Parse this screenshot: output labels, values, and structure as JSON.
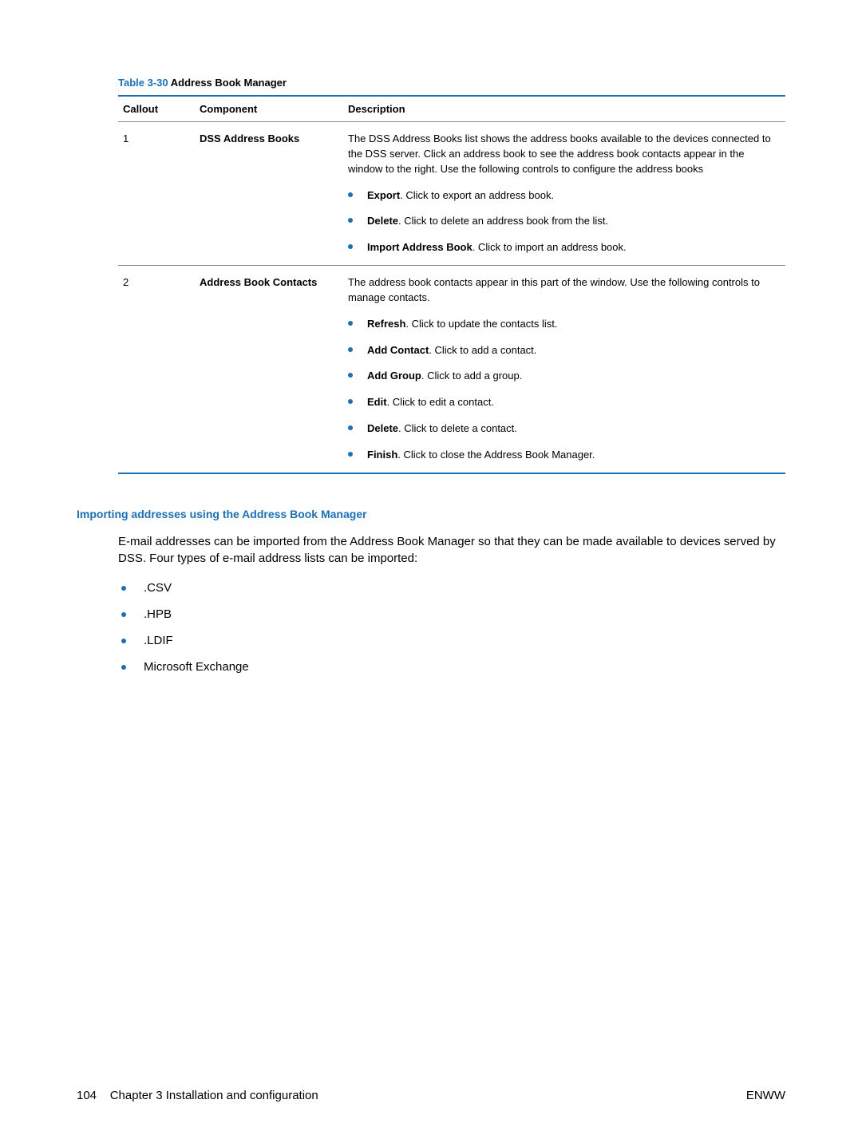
{
  "table": {
    "caption_label": "Table 3-30",
    "caption_title": "  Address Book Manager",
    "headers": {
      "callout": "Callout",
      "component": "Component",
      "description": "Description"
    },
    "rows": [
      {
        "callout": "1",
        "component": "DSS Address Books",
        "intro": "The DSS Address Books list shows the address books available to the devices connected to the DSS server. Click an address book to see the address book contacts appear in the window to the right. Use the following controls to configure the address books",
        "controls": [
          {
            "name": "Export",
            "text": ". Click to export an address book."
          },
          {
            "name": "Delete",
            "text": ". Click to delete an address book from the list."
          },
          {
            "name": "Import Address Book",
            "text": ". Click to import an address book."
          }
        ]
      },
      {
        "callout": "2",
        "component": "Address Book Contacts",
        "intro": "The address book contacts appear in this part of the window. Use the following controls to manage contacts.",
        "controls": [
          {
            "name": "Refresh",
            "text": ". Click to update the contacts list."
          },
          {
            "name": "Add Contact",
            "text": ". Click to add a contact."
          },
          {
            "name": "Add Group",
            "text": ". Click to add a group."
          },
          {
            "name": "Edit",
            "text": ". Click to edit a contact."
          },
          {
            "name": "Delete",
            "text": ". Click to delete a contact."
          },
          {
            "name": "Finish",
            "text": ". Click to close the Address Book Manager."
          }
        ]
      }
    ]
  },
  "section": {
    "heading": "Importing addresses using the Address Book Manager",
    "body": "E-mail addresses can be imported from the Address Book Manager so that they can be made available to devices served by DSS. Four types of e-mail address lists can be imported:",
    "formats": [
      ".CSV",
      ".HPB",
      ".LDIF",
      "Microsoft Exchange"
    ]
  },
  "footer": {
    "left_page": "104",
    "left_chapter": "Chapter 3   Installation and configuration",
    "right": "ENWW"
  }
}
